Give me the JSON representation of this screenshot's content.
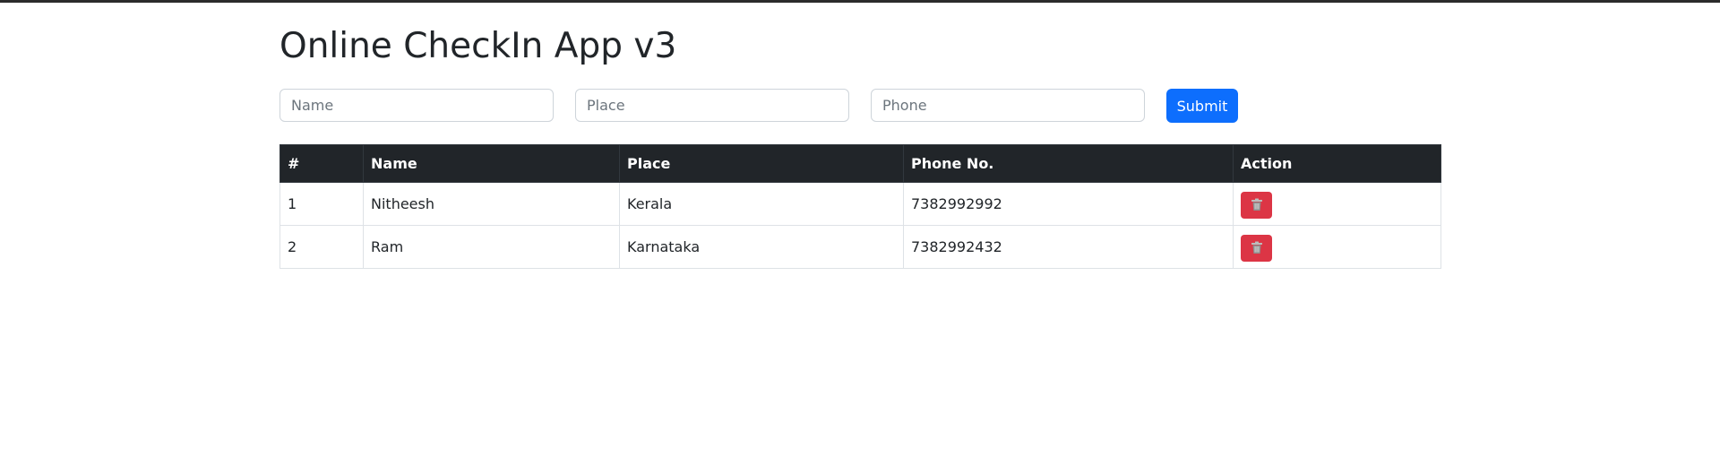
{
  "app": {
    "title": "Online CheckIn App v3"
  },
  "form": {
    "name_placeholder": "Name",
    "place_placeholder": "Place",
    "phone_placeholder": "Phone",
    "submit_label": "Submit"
  },
  "table": {
    "headers": [
      "#",
      "Name",
      "Place",
      "Phone No.",
      "Action"
    ],
    "rows": [
      {
        "index": "1",
        "name": "Nitheesh",
        "place": "Kerala",
        "phone": "7382992992",
        "action_icon": "trash-icon"
      },
      {
        "index": "2",
        "name": "Ram",
        "place": "Karnataka",
        "phone": "7382992432",
        "action_icon": "trash-icon"
      }
    ]
  },
  "colors": {
    "primary": "#0d6efd",
    "danger": "#dc3545",
    "table_header_bg": "#212529"
  }
}
